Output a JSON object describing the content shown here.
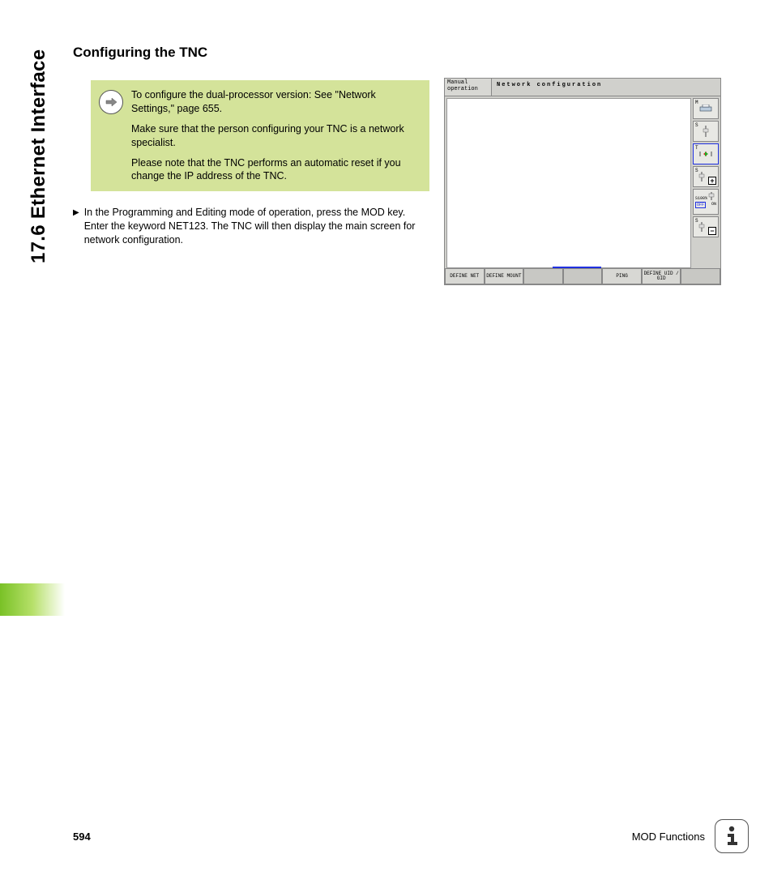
{
  "sideTitle": "17.6 Ethernet Interface",
  "heading": "Configuring the TNC",
  "note": {
    "p1": "To configure the dual-processor version: See \"Network Settings,\" page 655.",
    "p2": "Make sure that the person configuring your TNC is a network specialist.",
    "p3": "Please note that the TNC performs an automatic reset if you change the IP address of the TNC."
  },
  "step1": "In the Programming and Editing mode of operation, press the MOD key. Enter the keyword NET123. The TNC will then display the main screen for network configuration.",
  "screenshot": {
    "mode": "Manual operation",
    "title": "Network configuration",
    "right": {
      "r1": "M",
      "r2": "S",
      "r3": "T",
      "r4": "S",
      "s100": "S100%",
      "off": "OFF",
      "on": "ON",
      "r6": "S"
    },
    "softkeys": {
      "sk1": "DEFINE NET",
      "sk2": "DEFINE MOUNT",
      "sk3": "",
      "sk4": "",
      "sk5": "PING",
      "sk6": "DEFINE UID / GID",
      "sk7": ""
    }
  },
  "footer": {
    "page": "594",
    "section": "MOD Functions"
  }
}
